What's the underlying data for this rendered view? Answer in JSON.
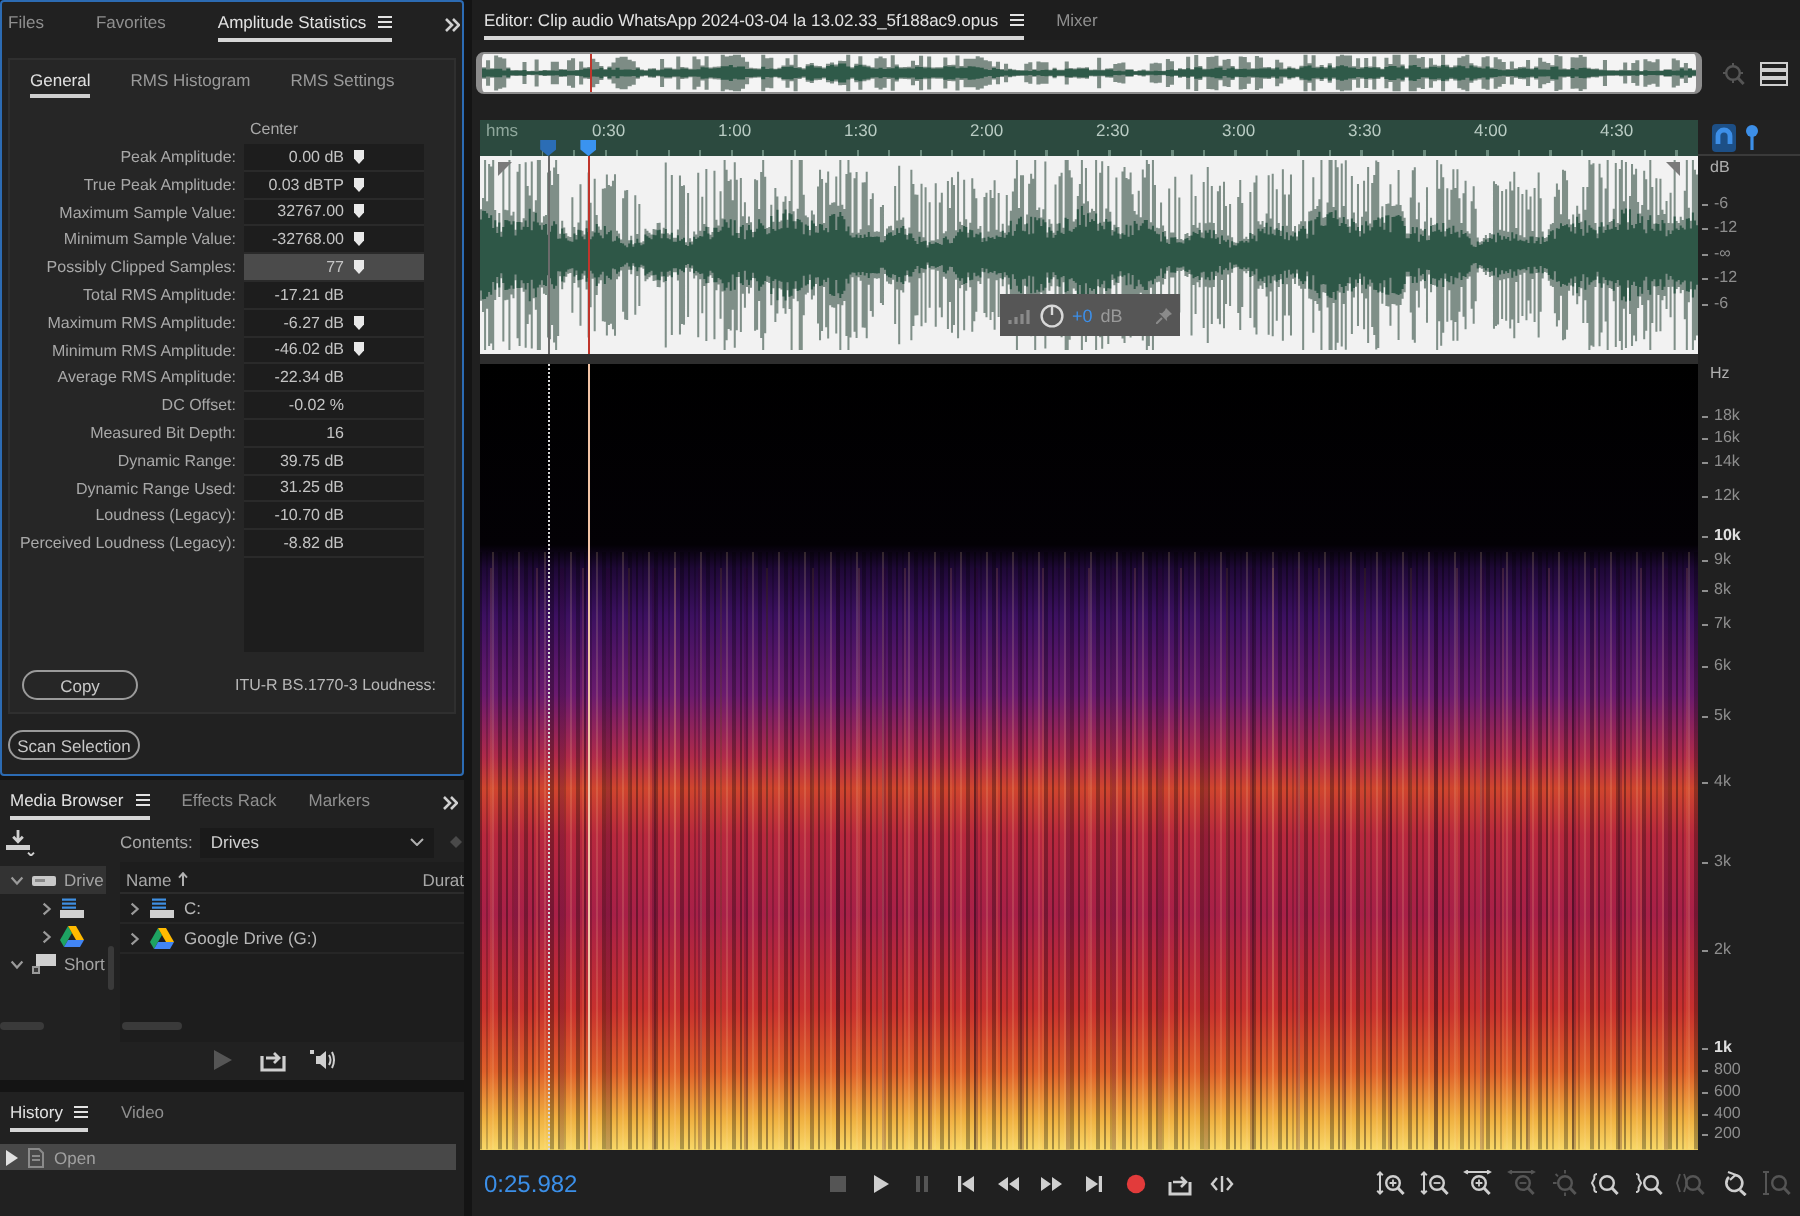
{
  "left_panel": {
    "tabs": [
      {
        "label": "Files",
        "selected": false
      },
      {
        "label": "Favorites",
        "selected": false
      },
      {
        "label": "Amplitude Statistics",
        "selected": true
      }
    ],
    "subtabs": [
      {
        "label": "General",
        "selected": true
      },
      {
        "label": "RMS Histogram",
        "selected": false
      },
      {
        "label": "RMS Settings",
        "selected": false
      }
    ],
    "column_header": "Center",
    "stats": [
      {
        "label": "Peak Amplitude:",
        "value": "0.00 dB",
        "has_marker": true,
        "selected": false
      },
      {
        "label": "True Peak Amplitude:",
        "value": "0.03 dBTP",
        "has_marker": true,
        "selected": false
      },
      {
        "label": "Maximum Sample Value:",
        "value": "32767.00",
        "has_marker": true,
        "selected": false
      },
      {
        "label": "Minimum Sample Value:",
        "value": "-32768.00",
        "has_marker": true,
        "selected": false
      },
      {
        "label": "Possibly Clipped Samples:",
        "value": "77",
        "has_marker": true,
        "selected": true
      },
      {
        "label": "Total RMS Amplitude:",
        "value": "-17.21 dB",
        "has_marker": false,
        "selected": false
      },
      {
        "label": "Maximum RMS Amplitude:",
        "value": "-6.27 dB",
        "has_marker": true,
        "selected": false
      },
      {
        "label": "Minimum RMS Amplitude:",
        "value": "-46.02 dB",
        "has_marker": true,
        "selected": false
      },
      {
        "label": "Average RMS Amplitude:",
        "value": "-22.34 dB",
        "has_marker": false,
        "selected": false
      },
      {
        "label": "DC Offset:",
        "value": "-0.02 %",
        "has_marker": false,
        "selected": false
      },
      {
        "label": "Measured Bit Depth:",
        "value": "16",
        "has_marker": false,
        "selected": false
      },
      {
        "label": "Dynamic Range:",
        "value": "39.75 dB",
        "has_marker": false,
        "selected": false
      },
      {
        "label": "Dynamic Range Used:",
        "value": "31.25 dB",
        "has_marker": false,
        "selected": false
      },
      {
        "label": "Loudness (Legacy):",
        "value": "-10.70 dB",
        "has_marker": false,
        "selected": false
      },
      {
        "label": "Perceived Loudness (Legacy):",
        "value": "-8.82 dB",
        "has_marker": false,
        "selected": false
      }
    ],
    "copy_button": "Copy",
    "loudness_label": "ITU-R BS.1770-3 Loudness:",
    "scan_button": "Scan Selection"
  },
  "media_browser": {
    "tabs": [
      {
        "label": "Media Browser",
        "selected": true
      },
      {
        "label": "Effects Rack",
        "selected": false
      },
      {
        "label": "Markers",
        "selected": false
      }
    ],
    "contents_label": "Contents:",
    "contents_value": "Drives",
    "tree": [
      {
        "kind": "drives",
        "label": "Drive",
        "expanded": true,
        "selected": true,
        "children": [
          {
            "kind": "disk",
            "expanded": false,
            "selected": false
          },
          {
            "kind": "cloud",
            "expanded": false,
            "selected": false
          }
        ]
      },
      {
        "kind": "shortcut",
        "label": "Short",
        "expanded": true,
        "selected": false
      }
    ],
    "columns": [
      {
        "label": "Name",
        "sorted": true
      },
      {
        "label": "Durat",
        "sorted": false
      }
    ],
    "files": [
      {
        "kind": "disk",
        "name": "C:",
        "expanded": false
      },
      {
        "kind": "cloud",
        "name": "Google Drive (G:)",
        "expanded": false
      }
    ],
    "preview_controls": [
      {
        "kind": "play",
        "disabled": true
      },
      {
        "kind": "insert",
        "disabled": false
      },
      {
        "kind": "autoplay",
        "disabled": false
      }
    ]
  },
  "history": {
    "tabs": [
      {
        "label": "History",
        "selected": true
      },
      {
        "label": "Video",
        "selected": false
      }
    ],
    "items": [
      {
        "label": "Open",
        "selected": true
      }
    ]
  },
  "editor": {
    "tabs": [
      {
        "label": "Editor: Clip audio WhatsApp 2024-03-04 la 13.02.33_5f188ac9.opus",
        "selected": true
      },
      {
        "label": "Mixer",
        "selected": false
      }
    ],
    "overview_tools": [
      {
        "kind": "zoom",
        "disabled": true
      },
      {
        "kind": "layout",
        "disabled": false
      }
    ],
    "ruler_unit": "hms",
    "ruler_labels": [
      "0:30",
      "1:00",
      "1:30",
      "2:00",
      "2:30",
      "3:00",
      "3:30",
      "4:00",
      "4:30"
    ],
    "ruler_tools": [
      {
        "kind": "magnet",
        "on": true
      },
      {
        "kind": "pin",
        "on": false
      }
    ],
    "start_marker": {
      "level": 0.056
    },
    "playhead": {
      "level": 0.089
    },
    "db_unit": "dB",
    "db_scale": [
      "-6",
      "-12",
      "-∞",
      "-12",
      "-6"
    ],
    "gain": {
      "value": "+0",
      "unit": "dB"
    },
    "hz_unit": "Hz",
    "hz_scale": [
      {
        "label": "18k",
        "major": false
      },
      {
        "label": "16k",
        "major": false
      },
      {
        "label": "14k",
        "major": false
      },
      {
        "label": "12k",
        "major": false
      },
      {
        "label": "10k",
        "major": true
      },
      {
        "label": "9k",
        "major": false
      },
      {
        "label": "8k",
        "major": false
      },
      {
        "label": "7k",
        "major": false
      },
      {
        "label": "6k",
        "major": false
      },
      {
        "label": "5k",
        "major": false
      },
      {
        "label": "4k",
        "major": false
      },
      {
        "label": "3k",
        "major": false
      },
      {
        "label": "2k",
        "major": false
      },
      {
        "label": "1k",
        "major": true
      },
      {
        "label": "800",
        "major": false
      },
      {
        "label": "600",
        "major": false
      },
      {
        "label": "400",
        "major": false
      },
      {
        "label": "200",
        "major": false
      }
    ],
    "time": "0:25.982",
    "transport": [
      {
        "kind": "stop",
        "disabled": true
      },
      {
        "kind": "play",
        "disabled": false
      },
      {
        "kind": "pause",
        "disabled": true
      },
      {
        "kind": "to_start",
        "disabled": false
      },
      {
        "kind": "rewind",
        "disabled": false
      },
      {
        "kind": "forward",
        "disabled": false
      },
      {
        "kind": "to_end",
        "disabled": false
      },
      {
        "kind": "record",
        "disabled": false
      },
      {
        "kind": "loop",
        "disabled": false
      },
      {
        "kind": "skip",
        "disabled": false
      }
    ],
    "zoom_tools": [
      {
        "kind": "amp_in",
        "disabled": false
      },
      {
        "kind": "amp_out",
        "disabled": false
      },
      {
        "kind": "time_in",
        "disabled": false
      },
      {
        "kind": "time_out",
        "disabled": true
      },
      {
        "kind": "full",
        "disabled": true
      },
      {
        "kind": "in_point",
        "disabled": false
      },
      {
        "kind": "out_point",
        "disabled": false
      },
      {
        "kind": "selection",
        "disabled": true
      },
      {
        "kind": "reset",
        "disabled": false
      },
      {
        "kind": "amp_full",
        "disabled": true
      }
    ]
  }
}
